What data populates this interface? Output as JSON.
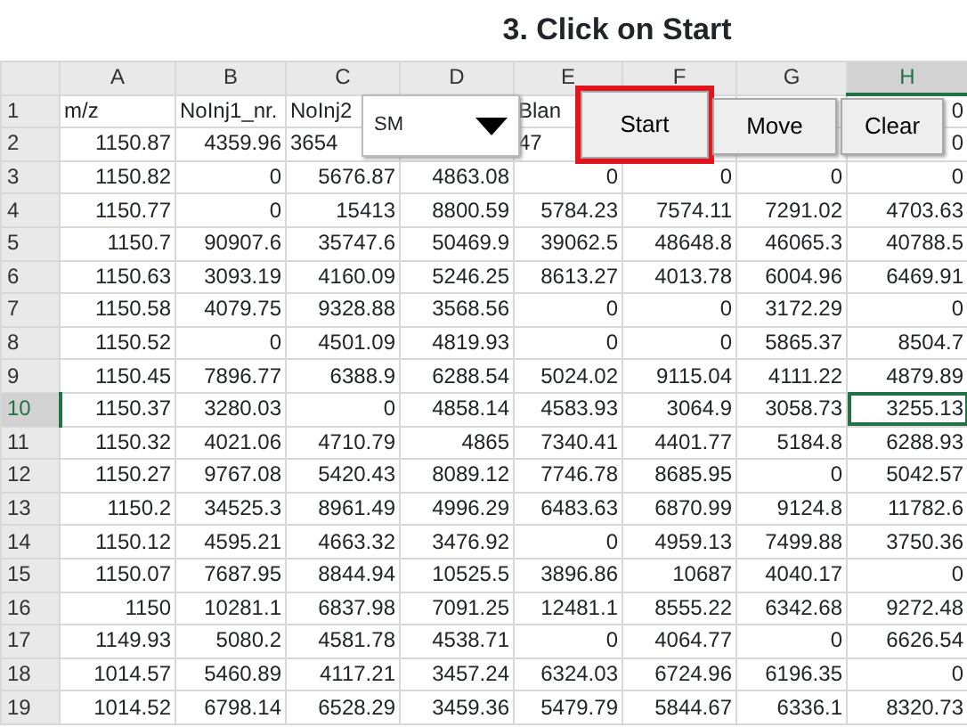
{
  "title": "3. Click on Start",
  "columns": [
    {
      "label": "A",
      "selected": false
    },
    {
      "label": "B",
      "selected": false
    },
    {
      "label": "C",
      "selected": false
    },
    {
      "label": "D",
      "selected": false
    },
    {
      "label": "E",
      "selected": false
    },
    {
      "label": "F",
      "selected": false
    },
    {
      "label": "G",
      "selected": false
    },
    {
      "label": "H",
      "selected": true
    }
  ],
  "rows": [
    {
      "number": "1",
      "selected": false,
      "cells": [
        {
          "text": "m/z",
          "kind": "text"
        },
        {
          "text": "NoInj1_nr.",
          "kind": "text"
        },
        {
          "text": "NoInj2",
          "kind": "text"
        },
        null,
        {
          "text": "Blan",
          "kind": "text"
        },
        null,
        null,
        {
          "text": "0",
          "kind": "number"
        }
      ]
    },
    {
      "number": "2",
      "selected": false,
      "cells": [
        {
          "text": "1150.87",
          "kind": "number"
        },
        {
          "text": "4359.96",
          "kind": "number"
        },
        {
          "text": "3654",
          "kind": "text"
        },
        null,
        {
          "text": "47",
          "kind": "text"
        },
        null,
        null,
        {
          "text": "0",
          "kind": "number"
        }
      ]
    },
    {
      "number": "3",
      "selected": false,
      "cells": [
        "1150.82",
        "0",
        "5676.87",
        "4863.08",
        "0",
        "0",
        "0",
        "0"
      ]
    },
    {
      "number": "4",
      "selected": false,
      "cells": [
        "1150.77",
        "0",
        "15413",
        "8800.59",
        "5784.23",
        "7574.11",
        "7291.02",
        "4703.63"
      ]
    },
    {
      "number": "5",
      "selected": false,
      "cells": [
        "1150.7",
        "90907.6",
        "35747.6",
        "50469.9",
        "39062.5",
        "48648.8",
        "46065.3",
        "40788.5"
      ]
    },
    {
      "number": "6",
      "selected": false,
      "cells": [
        "1150.63",
        "3093.19",
        "4160.09",
        "5246.25",
        "8613.27",
        "4013.78",
        "6004.96",
        "6469.91"
      ]
    },
    {
      "number": "7",
      "selected": false,
      "cells": [
        "1150.58",
        "4079.75",
        "9328.88",
        "3568.56",
        "0",
        "0",
        "3172.29",
        "0"
      ]
    },
    {
      "number": "8",
      "selected": false,
      "cells": [
        "1150.52",
        "0",
        "4501.09",
        "4819.93",
        "0",
        "0",
        "5865.37",
        "8504.7"
      ]
    },
    {
      "number": "9",
      "selected": false,
      "cells": [
        "1150.45",
        "7896.77",
        "6388.9",
        "6288.54",
        "5024.02",
        "9115.04",
        "4111.22",
        "4879.89"
      ]
    },
    {
      "number": "10",
      "selected": true,
      "cells": [
        "1150.37",
        "3280.03",
        "0",
        "4858.14",
        "4583.93",
        "3064.9",
        "3058.73",
        {
          "text": "3255.13",
          "kind": "number",
          "selected": true
        }
      ]
    },
    {
      "number": "11",
      "selected": false,
      "cells": [
        "1150.32",
        "4021.06",
        "4710.79",
        "4865",
        "7340.41",
        "4401.77",
        "5184.8",
        "6288.93"
      ]
    },
    {
      "number": "12",
      "selected": false,
      "cells": [
        "1150.27",
        "9767.08",
        "5420.43",
        "8089.12",
        "7746.78",
        "8685.95",
        "0",
        "5042.57"
      ]
    },
    {
      "number": "13",
      "selected": false,
      "cells": [
        "1150.2",
        "34525.3",
        "8961.49",
        "4996.29",
        "6483.63",
        "6870.99",
        "9124.8",
        "11782.6"
      ]
    },
    {
      "number": "14",
      "selected": false,
      "cells": [
        "1150.12",
        "4595.21",
        "4663.32",
        "3476.92",
        "0",
        "4959.13",
        "7499.88",
        "3750.36"
      ]
    },
    {
      "number": "15",
      "selected": false,
      "cells": [
        "1150.07",
        "7687.95",
        "8844.94",
        "10525.5",
        "3896.86",
        "10687",
        "4040.17",
        "0"
      ]
    },
    {
      "number": "16",
      "selected": false,
      "cells": [
        "1150",
        "10281.1",
        "6837.98",
        "7091.25",
        "12481.1",
        "8555.22",
        "6342.68",
        "9272.48"
      ]
    },
    {
      "number": "17",
      "selected": false,
      "cells": [
        "1149.93",
        "5080.2",
        "4581.78",
        "4538.71",
        "0",
        "4064.77",
        "0",
        "6626.54"
      ]
    },
    {
      "number": "18",
      "selected": false,
      "cells": [
        "1014.57",
        "5460.89",
        "4117.21",
        "3457.24",
        "6324.03",
        "6724.96",
        "6196.35",
        "0"
      ]
    },
    {
      "number": "19",
      "selected": false,
      "cells": [
        "1014.52",
        "6798.14",
        "6528.29",
        "3459.36",
        "5479.79",
        "5844.67",
        "6336.1",
        "8320.73"
      ]
    }
  ],
  "dropdown": {
    "value": "SM"
  },
  "buttons": [
    {
      "label": "Start",
      "highlighted": true
    },
    {
      "label": "Move",
      "highlighted": false
    },
    {
      "label": "Clear",
      "highlighted": false
    }
  ]
}
